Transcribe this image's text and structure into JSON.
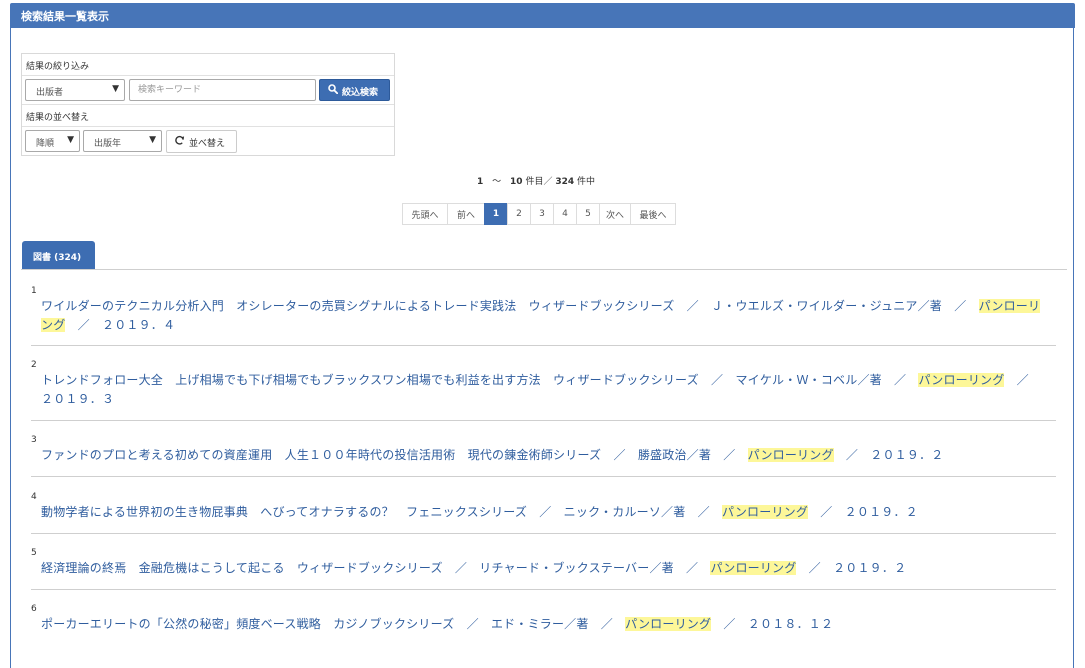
{
  "header": {
    "title": "検索結果一覧表示"
  },
  "filter": {
    "narrow_label": "結果の絞り込み",
    "field_select": "出版者",
    "keyword_placeholder": "検索キーワード",
    "narrow_button": "絞込検索",
    "sort_label": "結果の並べ替え",
    "order_select": "降順",
    "sort_field_select": "出版年",
    "sort_button": "並べ替え"
  },
  "count": {
    "from": "1",
    "tilde": "〜",
    "to": "10",
    "to_suffix": "件目／",
    "total": "324",
    "total_suffix": "件中"
  },
  "pager": {
    "first": "先頭へ",
    "prev": "前へ",
    "pages": [
      "1",
      "2",
      "3",
      "4",
      "5"
    ],
    "next": "次へ",
    "last": "最後へ"
  },
  "tab": {
    "label": "図書 (324)"
  },
  "accent_color": "#3d6db2",
  "highlight_color": "#fdf799",
  "results": [
    {
      "num": "1",
      "title": "ワイルダーのテクニカル分析入門　オシレーターの売買シグナルによるトレード実践法　ウィザードブックシリーズ　／　Ｊ・ウエルズ・ワイルダー・ジュニア／著　／　",
      "publisher": "パンローリング",
      "tail": "　／　２０１９．４"
    },
    {
      "num": "2",
      "title": "トレンドフォロー大全　上げ相場でも下げ相場でもブラックスワン相場でも利益を出す方法　ウィザードブックシリーズ　／　マイケル・Ｗ・コベル／著　／　",
      "publisher": "パンローリング",
      "tail": "　／　２０１９．３"
    },
    {
      "num": "3",
      "title": "ファンドのプロと考える初めての資産運用　人生１００年時代の投信活用術　現代の錬金術師シリーズ　／　勝盛政治／著　／　",
      "publisher": "パンローリング",
      "tail": "　／　２０１９．２"
    },
    {
      "num": "4",
      "title": "動物学者による世界初の生き物屁事典　へびってオナラするの？　フェニックスシリーズ　／　ニック・カルーソ／著　／　",
      "publisher": "パンローリング",
      "tail": "　／　２０１９．２"
    },
    {
      "num": "5",
      "title": "経済理論の終焉　金融危機はこうして起こる　ウィザードブックシリーズ　／　リチャード・ブックステーバー／著　／　",
      "publisher": "パンローリング",
      "tail": "　／　２０１９．２"
    },
    {
      "num": "6",
      "title": "ポーカーエリートの「公然の秘密」頻度ベース戦略　カジノブックシリーズ　／　エド・ミラー／著　／　",
      "publisher": "パンローリング",
      "tail": "　／　２０１８．１２"
    }
  ]
}
